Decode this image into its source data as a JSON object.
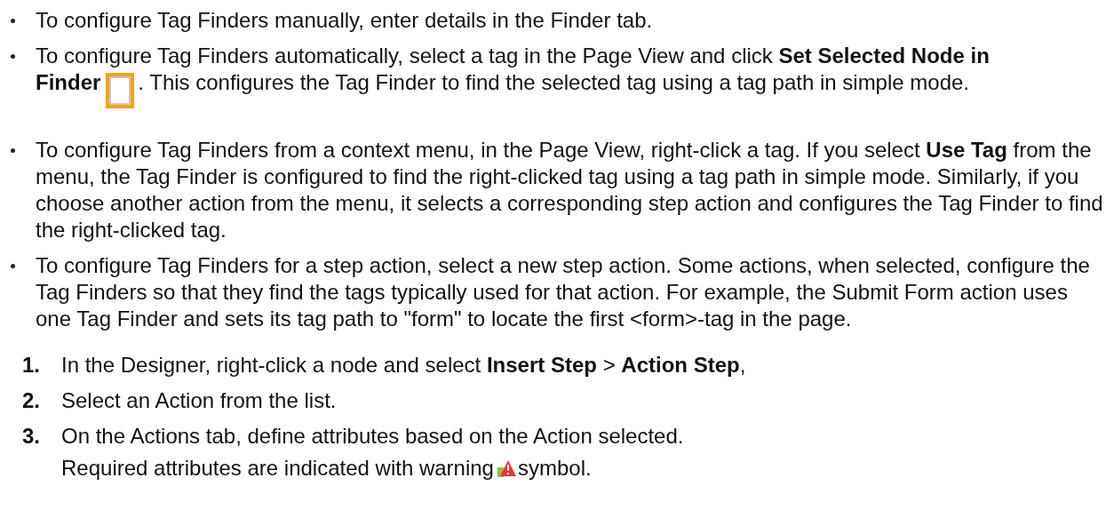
{
  "bullets": [
    {
      "parts": [
        {
          "kind": "text",
          "text": "To configure Tag Finders manually, enter details in the Finder tab."
        }
      ]
    },
    {
      "parts": [
        {
          "kind": "text",
          "text": "To configure Tag Finders automatically, select a tag in the Page View and click **Set Selected Node in**"
        },
        {
          "kind": "break"
        },
        {
          "kind": "text",
          "text": "**Finder**"
        },
        {
          "kind": "icon"
        },
        {
          "kind": "text",
          "text": ". This configures the Tag Finder to find the selected tag using a tag path in simple mode."
        }
      ]
    },
    {
      "parts": [
        {
          "kind": "text",
          "text": "To configure Tag Finders from a context menu, in the Page View, right-click a tag. If you select **Use Tag** from the menu, the Tag Finder is configured to find the right-clicked tag using a tag path in simple mode. Similarly, if you choose another action from the menu, it selects a corresponding step action and configures the Tag Finder to find the right-clicked tag."
        }
      ]
    },
    {
      "parts": [
        {
          "kind": "text",
          "text": "To configure Tag Finders for a step action, select a new step action. Some actions, when selected, configure the Tag Finders so that they find the tags typically used for that action. For example, the Submit Form action uses one Tag Finder and sets its tag path to \"form\" to locate the first <form>-tag in the page."
        }
      ]
    }
  ],
  "steps": [
    {
      "number": "1.",
      "text": "In the Designer, right-click a node and select **Insert Step** > **Action Step**,"
    },
    {
      "number": "2.",
      "text": "Select an Action from the list."
    },
    {
      "number": "3.",
      "text": "On the Actions tab, define attributes based on the Action selected.",
      "note": {
        "before": "Required attributes are indicated with warning",
        "after": "symbol."
      }
    }
  ]
}
